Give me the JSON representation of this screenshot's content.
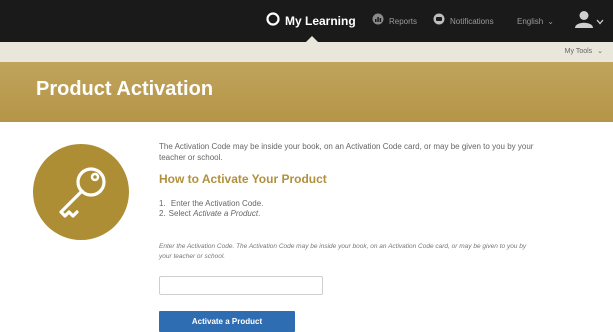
{
  "topnav": {
    "items": [
      {
        "label": "My Learning",
        "icon": "my-learning-icon",
        "active": true
      },
      {
        "label": "Reports",
        "icon": "reports-icon",
        "active": false
      },
      {
        "label": "Notifications",
        "icon": "notifications-icon",
        "active": false
      }
    ],
    "language": "English",
    "user_icon": "user-icon"
  },
  "subnav": {
    "my_tools": "My Tools"
  },
  "banner": {
    "title": "Product Activation",
    "color": "#b59547"
  },
  "content": {
    "intro": "The Activation Code may be inside your book, on an Activation Code card, or may be given to you by your teacher or school.",
    "heading": "How to Activate Your Product",
    "steps": [
      {
        "num": "1.",
        "text": "Enter the Activation Code."
      },
      {
        "num": "2.",
        "text_prefix": "Select ",
        "text_emphasis": "Activate a Product",
        "text_suffix": "."
      }
    ],
    "hint": "Enter the Activation Code. The Activation Code may be inside your book, on an Activation Code card, or may be given to you by your teacher or school.",
    "code_input": {
      "value": "",
      "placeholder": ""
    },
    "activate_button": "Activate a Product",
    "key_icon": "key-icon",
    "accent_color": "#ad8e35",
    "button_color": "#2f6db2"
  }
}
